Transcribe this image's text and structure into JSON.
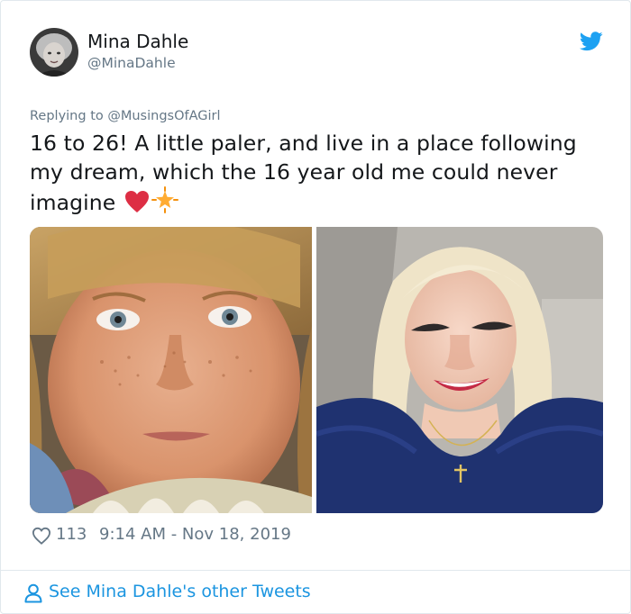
{
  "tweet": {
    "author": {
      "display_name": "Mina Dahle",
      "handle": "@MinaDahle"
    },
    "reply": {
      "prefix": "Replying to",
      "mention": "@MusingsOfAGirl"
    },
    "text": "16 to 26! A little paler, and live in a place following my dream, which  the 16 year old me could never imagine",
    "emojis": [
      "red-heart-icon",
      "glowing-star-icon"
    ],
    "photos": [
      {
        "name": "younger-self-photo"
      },
      {
        "name": "current-self-photo"
      }
    ],
    "likes": "113",
    "timestamp": "9:14 AM - Nov 18, 2019",
    "footer_link": "See Mina Dahle's other Tweets"
  },
  "colors": {
    "text_primary": "#14171a",
    "text_secondary": "#657786",
    "link_blue": "#1b95e0",
    "twitter_blue": "#1da1f2",
    "heart_red": "#e0245e",
    "border": "#e1e8ed"
  },
  "icons": {
    "brand": "twitter-bird-icon",
    "like": "heart-outline-icon",
    "footer": "person-icon"
  }
}
